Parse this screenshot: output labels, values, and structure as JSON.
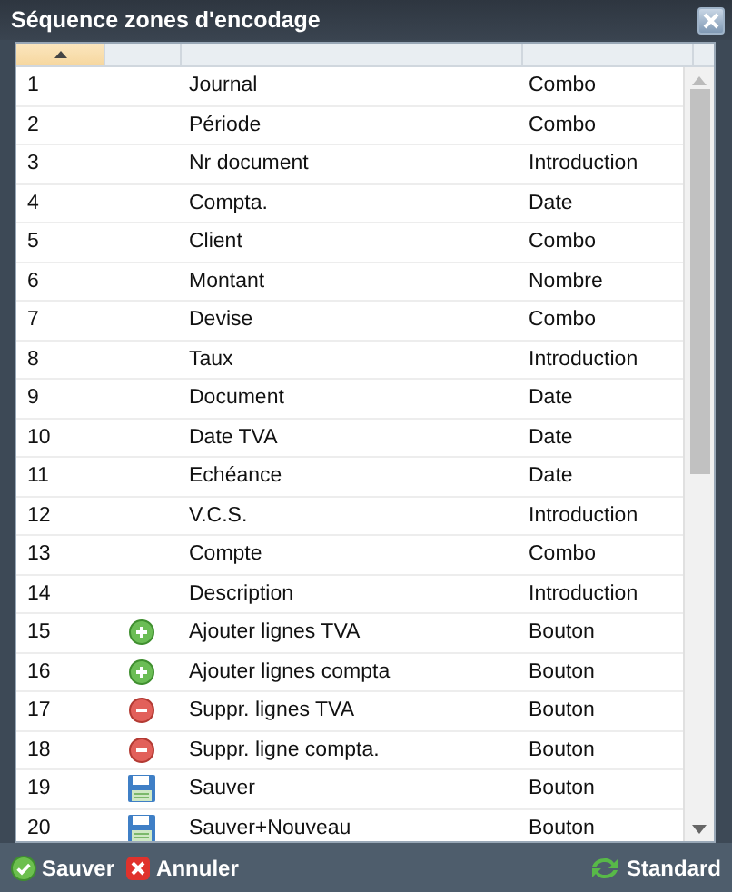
{
  "window": {
    "title": "Séquence zones d'encodage"
  },
  "table": {
    "columns": [
      {
        "sorted": true
      },
      {
        "sorted": false
      },
      {
        "sorted": false
      },
      {
        "sorted": false
      }
    ],
    "rows": [
      {
        "number": "1",
        "kind": "field",
        "name": "Journal",
        "type": "Combo"
      },
      {
        "number": "2",
        "kind": "field",
        "name": "Période",
        "type": "Combo"
      },
      {
        "number": "3",
        "kind": "field",
        "name": "Nr document",
        "type": "Introduction"
      },
      {
        "number": "4",
        "kind": "field",
        "name": "Compta.",
        "type": "Date"
      },
      {
        "number": "5",
        "kind": "field",
        "name": "Client",
        "type": "Combo"
      },
      {
        "number": "6",
        "kind": "field",
        "name": "Montant",
        "type": "Nombre"
      },
      {
        "number": "7",
        "kind": "field",
        "name": "Devise",
        "type": "Combo"
      },
      {
        "number": "8",
        "kind": "field",
        "name": "Taux",
        "type": "Introduction"
      },
      {
        "number": "9",
        "kind": "field",
        "name": "Document",
        "type": "Date"
      },
      {
        "number": "10",
        "kind": "field",
        "name": "Date TVA",
        "type": "Date"
      },
      {
        "number": "11",
        "kind": "field",
        "name": "Echéance",
        "type": "Date"
      },
      {
        "number": "12",
        "kind": "field",
        "name": "V.C.S.",
        "type": "Introduction"
      },
      {
        "number": "13",
        "kind": "field",
        "name": "Compte",
        "type": "Combo"
      },
      {
        "number": "14",
        "kind": "field",
        "name": "Description",
        "type": "Introduction"
      },
      {
        "number": "15",
        "kind": "add",
        "name": "Ajouter lignes TVA",
        "type": "Bouton"
      },
      {
        "number": "16",
        "kind": "add",
        "name": "Ajouter lignes compta",
        "type": "Bouton"
      },
      {
        "number": "17",
        "kind": "remove",
        "name": "Suppr. lignes TVA",
        "type": "Bouton"
      },
      {
        "number": "18",
        "kind": "remove",
        "name": "Suppr. ligne compta.",
        "type": "Bouton"
      },
      {
        "number": "19",
        "kind": "save",
        "name": "Sauver",
        "type": "Bouton"
      },
      {
        "number": "20",
        "kind": "save",
        "name": "Sauver+Nouveau",
        "type": "Bouton"
      }
    ]
  },
  "footer": {
    "buttons": [
      {
        "kind": "ok",
        "label": "Sauver"
      },
      {
        "kind": "cancel",
        "label": "Annuler"
      },
      {
        "kind": "reset",
        "label": "Standard"
      }
    ]
  }
}
